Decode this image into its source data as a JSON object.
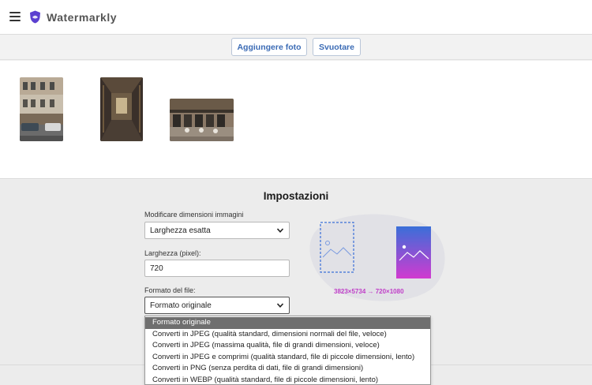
{
  "app": {
    "title": "Watermarkly"
  },
  "toolbar": {
    "add_label": "Aggiungere foto",
    "clear_label": "Svuotare"
  },
  "settings": {
    "title": "Impostazioni",
    "resize_label": "Modificare dimensioni immagini",
    "resize_value": "Larghezza esatta",
    "width_label": "Larghezza (pixel):",
    "width_value": "720",
    "format_label": "Formato del file:",
    "format_value": "Formato originale",
    "dimensions_text": "3823×5734 → 720×1080"
  },
  "dropdown": {
    "options": [
      "Formato originale",
      "Converti in JPEG (qualità standard, dimensioni normali del file, veloce)",
      "Converti in JPEG (massima qualità, file di grandi dimensioni, veloce)",
      "Converti in JPEG e comprimi (qualità standard, file di piccole dimensioni, lento)",
      "Converti in PNG (senza perdita di dati, file di grandi dimensioni)",
      "Converti in WEBP (qualità standard, file di piccole dimensioni, lento)"
    ],
    "selected_index": 0
  },
  "colors": {
    "accent_blue": "#3b6bb5",
    "illustration_magenta": "#c03ec8",
    "logo_purple": "#5b3fd0"
  },
  "icons": [
    "menu-icon",
    "logo-shield-icon",
    "chevron-down-icon",
    "image-placeholder-icon"
  ]
}
